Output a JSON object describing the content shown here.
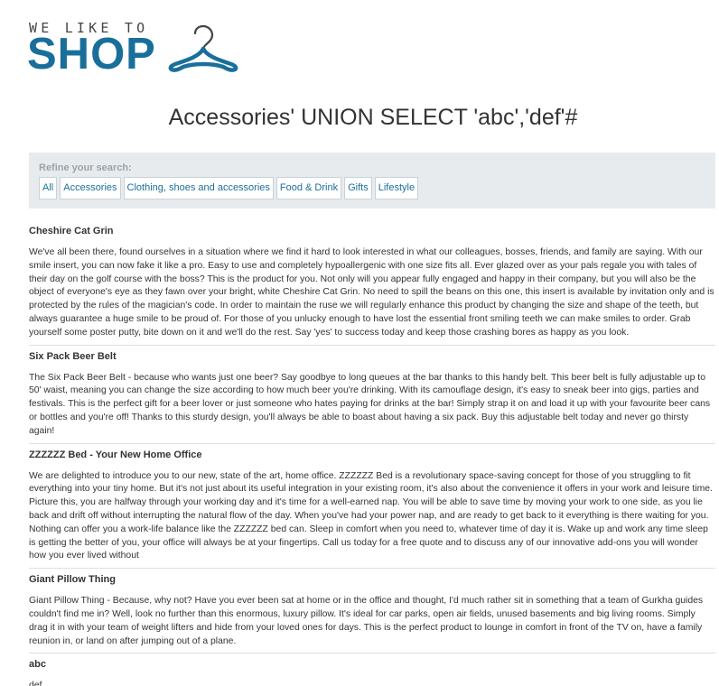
{
  "brand": {
    "tagline": "WE LIKE TO",
    "word": "SHOP",
    "accent_color": "#1a6f9a"
  },
  "page_title": "Accessories' UNION SELECT 'abc','def'#",
  "filter": {
    "label": "Refine your search:",
    "links": [
      "All",
      "Accessories",
      "Clothing, shoes and accessories",
      "Food & Drink",
      "Gifts",
      "Lifestyle"
    ]
  },
  "products": [
    {
      "name": "Cheshire Cat Grin",
      "description": "We've all been there, found ourselves in a situation where we find it hard to look interested in what our colleagues, bosses, friends, and family are saying. With our smile insert, you can now fake it like a pro. Easy to use and completely hypoallergenic with one size fits all. Ever glazed over as your pals regale you with tales of their day on the golf course with the boss? This is the product for you. Not only will you appear fully engaged and happy in their company, but you will also be the object of everyone's eye as they fawn over your bright, white Cheshire Cat Grin. No need to spill the beans on this one, this insert is available by invitation only and is protected by the rules of the magician's code. In order to maintain the ruse we will regularly enhance this product by changing the size and shape of the teeth, but always guarantee a huge smile to be proud of. For those of you unlucky enough to have lost the essential front smiling teeth we can make smiles to order. Grab yourself some poster putty, bite down on it and we'll do the rest. Say 'yes' to success today and keep those crashing bores as happy as you look."
    },
    {
      "name": "Six Pack Beer Belt",
      "description": "The Six Pack Beer Belt - because who wants just one beer? Say goodbye to long queues at the bar thanks to this handy belt. This beer belt is fully adjustable up to 50' waist, meaning you can change the size according to how much beer you're drinking. With its camouflage design, it's easy to sneak beer into gigs, parties and festivals. This is the perfect gift for a beer lover or just someone who hates paying for drinks at the bar! Simply strap it on and load it up with your favourite beer cans or bottles and you're off! Thanks to this sturdy design, you'll always be able to boast about having a six pack. Buy this adjustable belt today and never go thirsty again!"
    },
    {
      "name": "ZZZZZZ Bed - Your New Home Office",
      "description": "We are delighted to introduce you to our new, state of the art, home office. ZZZZZZ Bed is a revolutionary space-saving concept for those of you struggling to fit everything into your tiny home. But it's not just about its useful integration in your existing room, it's also about the convenience it offers in your work and leisure time. Picture this, you are halfway through your working day and it's time for a well-earned nap. You will be able to save time by moving your work to one side, as you lie back and drift off without interrupting the natural flow of the day. When you've had your power nap, and are ready to get back to it everything is there waiting for you. Nothing can offer you a work-life balance like the ZZZZZZ bed can. Sleep in comfort when you need to, whatever time of day it is. Wake up and work any time sleep is getting the better of you, your office will always be at your fingertips. Call us today for a free quote and to discuss any of our innovative add-ons you will wonder how you ever lived without"
    },
    {
      "name": "Giant Pillow Thing",
      "description": "Giant Pillow Thing - Because, why not? Have you ever been sat at home or in the office and thought, I'd much rather sit in something that a team of Gurkha guides couldn't find me in? Well, look no further than this enormous, luxury pillow. It's ideal for car parks, open air fields, unused basements and big living rooms. Simply drag it in with your team of weight lifters and hide from your loved ones for days. This is the perfect product to lounge in comfort in front of the TV on, have a family reunion in, or land on after jumping out of a plane."
    },
    {
      "name": "abc",
      "description": "def"
    }
  ]
}
